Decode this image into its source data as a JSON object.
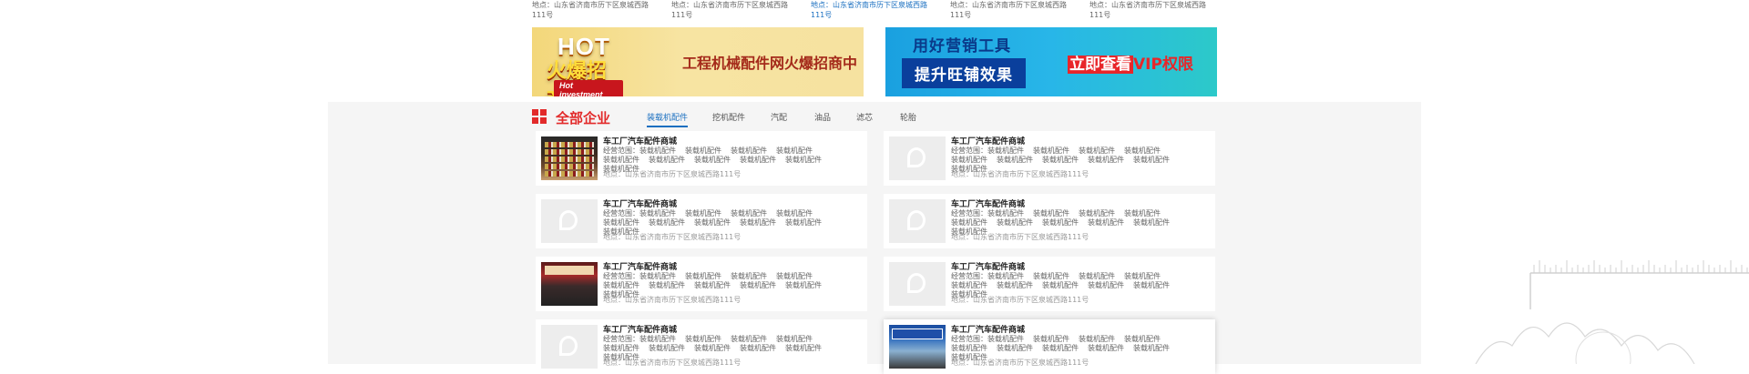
{
  "top_addresses": [
    {
      "text": "地点：山东省济南市历下区泉城西路111号",
      "active": false
    },
    {
      "text": "地点：山东省济南市历下区泉城西路111号",
      "active": false
    },
    {
      "text": "地点：山东省济南市历下区泉城西路111号",
      "active": true
    },
    {
      "text": "地点：山东省济南市历下区泉城西路111号",
      "active": false
    },
    {
      "text": "地点：山东省济南市历下区泉城西路111号",
      "active": false
    }
  ],
  "banner_left": {
    "hot": "HOT",
    "hot_cn": "火爆招商",
    "hot_sub": "Hot investment",
    "title": "工程机械配件网火爆招商中"
  },
  "banner_right": {
    "line1": "用好营销工具",
    "line2": "提升旺铺效果",
    "cta_a": "立即查看",
    "cta_b": "VIP",
    "cta_c": "权限"
  },
  "section": {
    "title": "全部企业",
    "tabs": [
      "装载机配件",
      "挖机配件",
      "汽配",
      "油品",
      "滤芯",
      "轮胎"
    ],
    "active_tab": 0
  },
  "cards": [
    {
      "title": "车工厂汽车配件商城",
      "scope_label": "经营范围：",
      "items": [
        "装载机配件",
        "装载机配件",
        "装载机配件",
        "装载机配件",
        "装载机配件",
        "装载机配件",
        "装载机配件",
        "装载机配件",
        "装载机配件",
        "装载机配件"
      ],
      "addr": "地点：山东省济南市历下区泉城西路111号",
      "thumb": "photo1"
    },
    {
      "title": "车工厂汽车配件商城",
      "scope_label": "经营范围：",
      "items": [
        "装载机配件",
        "装载机配件",
        "装载机配件",
        "装载机配件",
        "装载机配件",
        "装载机配件",
        "装载机配件",
        "装载机配件",
        "装载机配件",
        "装载机配件"
      ],
      "addr": "地点：山东省济南市历下区泉城西路111号",
      "thumb": "placeholder"
    },
    {
      "title": "车工厂汽车配件商城",
      "scope_label": "经营范围：",
      "items": [
        "装载机配件",
        "装载机配件",
        "装载机配件",
        "装载机配件",
        "装载机配件",
        "装载机配件",
        "装载机配件",
        "装载机配件",
        "装载机配件",
        "装载机配件"
      ],
      "addr": "地点：山东省济南市历下区泉城西路111号",
      "thumb": "placeholder"
    },
    {
      "title": "车工厂汽车配件商城",
      "scope_label": "经营范围：",
      "items": [
        "装载机配件",
        "装载机配件",
        "装载机配件",
        "装载机配件",
        "装载机配件",
        "装载机配件",
        "装载机配件",
        "装载机配件",
        "装载机配件",
        "装载机配件"
      ],
      "addr": "地点：山东省济南市历下区泉城西路111号",
      "thumb": "placeholder"
    },
    {
      "title": "车工厂汽车配件商城",
      "scope_label": "经营范围：",
      "items": [
        "装载机配件",
        "装载机配件",
        "装载机配件",
        "装载机配件",
        "装载机配件",
        "装载机配件",
        "装载机配件",
        "装载机配件",
        "装载机配件",
        "装载机配件"
      ],
      "addr": "地点：山东省济南市历下区泉城西路111号",
      "thumb": "photo2"
    },
    {
      "title": "车工厂汽车配件商城",
      "scope_label": "经营范围：",
      "items": [
        "装载机配件",
        "装载机配件",
        "装载机配件",
        "装载机配件",
        "装载机配件",
        "装载机配件",
        "装载机配件",
        "装载机配件",
        "装载机配件",
        "装载机配件"
      ],
      "addr": "地点：山东省济南市历下区泉城西路111号",
      "thumb": "placeholder"
    },
    {
      "title": "车工厂汽车配件商城",
      "scope_label": "经营范围：",
      "items": [
        "装载机配件",
        "装载机配件",
        "装载机配件",
        "装载机配件",
        "装载机配件",
        "装载机配件",
        "装载机配件",
        "装载机配件",
        "装载机配件",
        "装载机配件"
      ],
      "addr": "地点：山东省济南市历下区泉城西路111号",
      "thumb": "placeholder"
    },
    {
      "title": "车工厂汽车配件商城",
      "scope_label": "经营范围：",
      "items": [
        "装载机配件",
        "装载机配件",
        "装载机配件",
        "装载机配件",
        "装载机配件",
        "装载机配件",
        "装载机配件",
        "装载机配件",
        "装载机配件",
        "装载机配件"
      ],
      "addr": "地点：山东省济南市历下区泉城西路111号",
      "thumb": "photo3",
      "highlight": true
    }
  ],
  "colors": {
    "accent": "#1a6fc0",
    "brand_red": "#e22a2a"
  }
}
